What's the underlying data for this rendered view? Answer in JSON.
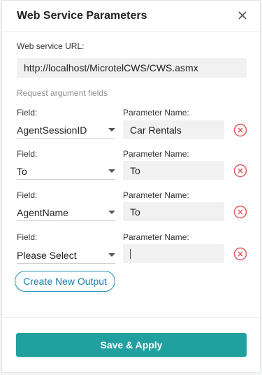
{
  "dialog": {
    "title": "Web Service Parameters",
    "close_icon": "close-icon",
    "url_label": "Web service URL:",
    "url_value": "http://localhost/MicrotelCWS/CWS.asmx",
    "section_label": "Request argument fields",
    "field_label": "Field:",
    "param_label": "Parameter Name:",
    "rows": [
      {
        "field": "AgentSessionID",
        "parameter": "Car Rentals"
      },
      {
        "field": "To",
        "parameter": "To"
      },
      {
        "field": "AgentName",
        "parameter": "To"
      },
      {
        "field": "Please Select",
        "parameter": ""
      }
    ],
    "create_button": "Create New Output",
    "save_button": "Save & Apply"
  },
  "colors": {
    "accent": "#21a0a0",
    "link": "#1f7fa8",
    "remove": "#e05a5a"
  },
  "icons": {
    "remove": "remove-circle-icon",
    "dropdown": "chevron-down-icon"
  }
}
